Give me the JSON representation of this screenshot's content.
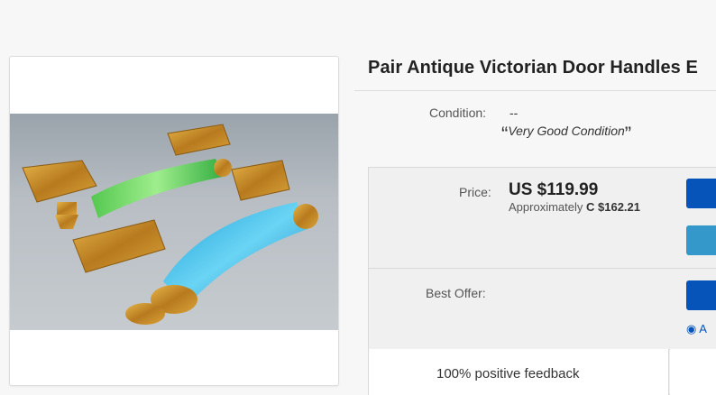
{
  "listing": {
    "title": "Pair Antique Victorian Door Handles E",
    "condition_label": "Condition:",
    "condition_value": "--",
    "condition_desc": "Very Good Condition",
    "quote_open": "“",
    "quote_close": "”"
  },
  "price": {
    "label": "Price:",
    "value": "US $119.99",
    "approx_prefix": "Approximately",
    "approx_value": "C $162.21"
  },
  "offer": {
    "label": "Best Offer:"
  },
  "watch": {
    "text": "A"
  },
  "seller": {
    "feedback": "100% positive feedback"
  },
  "colors": {
    "primary_button": "#0654ba",
    "secondary_button": "#3498ca"
  }
}
